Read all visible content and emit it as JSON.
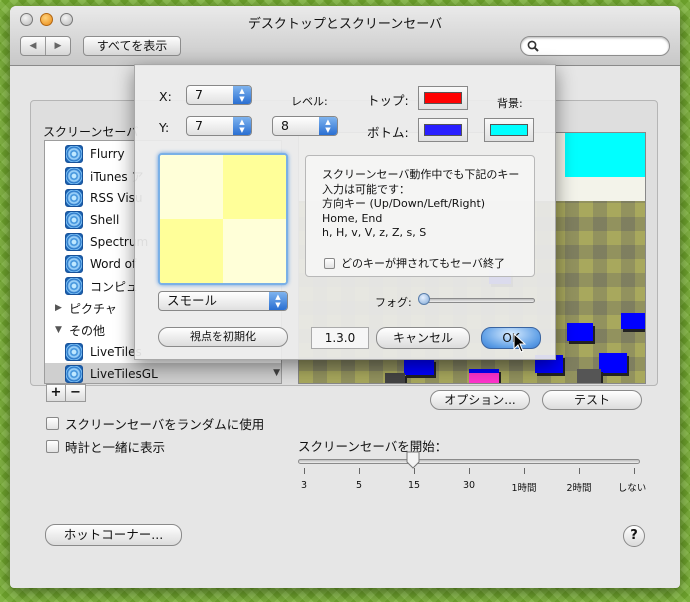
{
  "window": {
    "title": "デスクトップとスクリーンセーバ"
  },
  "toolbar": {
    "back_label": "◀",
    "forward_label": "▶",
    "show_all_label": "すべてを表示",
    "search_placeholder": ""
  },
  "screensaver_list": {
    "label": "スクリーンセーバ",
    "items": [
      {
        "label": "Flurry"
      },
      {
        "label": "iTunes ア"
      },
      {
        "label": "RSS Visu"
      },
      {
        "label": "Shell"
      },
      {
        "label": "Spectrum"
      },
      {
        "label": "Word of"
      },
      {
        "label": "コンピュ"
      },
      {
        "label": "ピクチャ"
      },
      {
        "label": "その他"
      },
      {
        "label": "LiveTiles"
      },
      {
        "label": "LiveTilesGL"
      }
    ],
    "add_label": "+",
    "remove_label": "−"
  },
  "buttons": {
    "options_label": "オプション...",
    "test_label": "テスト",
    "hot_corners_label": "ホットコーナー...",
    "help_label": "?"
  },
  "checkboxes": {
    "random_label": "スクリーンセーバをランダムに使用",
    "clock_label": "時計と一緒に表示",
    "random_checked": false,
    "clock_checked": false
  },
  "start_after": {
    "label": "スクリーンセーバを開始：",
    "ticks": [
      "3",
      "5",
      "15",
      "30",
      "1時間",
      "2時間",
      "しない"
    ],
    "selected": "15"
  },
  "sheet": {
    "x_label": "X:",
    "x_value": "7",
    "y_label": "Y:",
    "y_value": "7",
    "level_label": "レベル:",
    "level_value": "8",
    "top_label": "トップ:",
    "top_color": "#ff0000",
    "bottom_label": "ボトム:",
    "bottom_color": "#2a1fff",
    "background_label": "背景:",
    "background_color": "#00ffff",
    "size_value": "スモール",
    "info_text": "スクリーンセーバ動作中でも下記のキー\n入力は可能です：\n方向キー (Up/Down/Left/Right)\nHome, End\nh, H, v, V, z, Z, s, S",
    "quit_any_key_label": "どのキーが押されてもセーバ終了",
    "quit_any_key_checked": false,
    "fog_label": "フォグ:",
    "fog_level": 0.0,
    "reset_view_label": "視点を初期化",
    "version": "1.3.0",
    "cancel_label": "キャンセル",
    "ok_label": "OK"
  },
  "colors": {
    "preview_pale_yellow": "#ffffd8",
    "preview_yellow": "#ffff99",
    "tile_blue": "#0000ff",
    "tile_magenta": "#ff33cc"
  }
}
